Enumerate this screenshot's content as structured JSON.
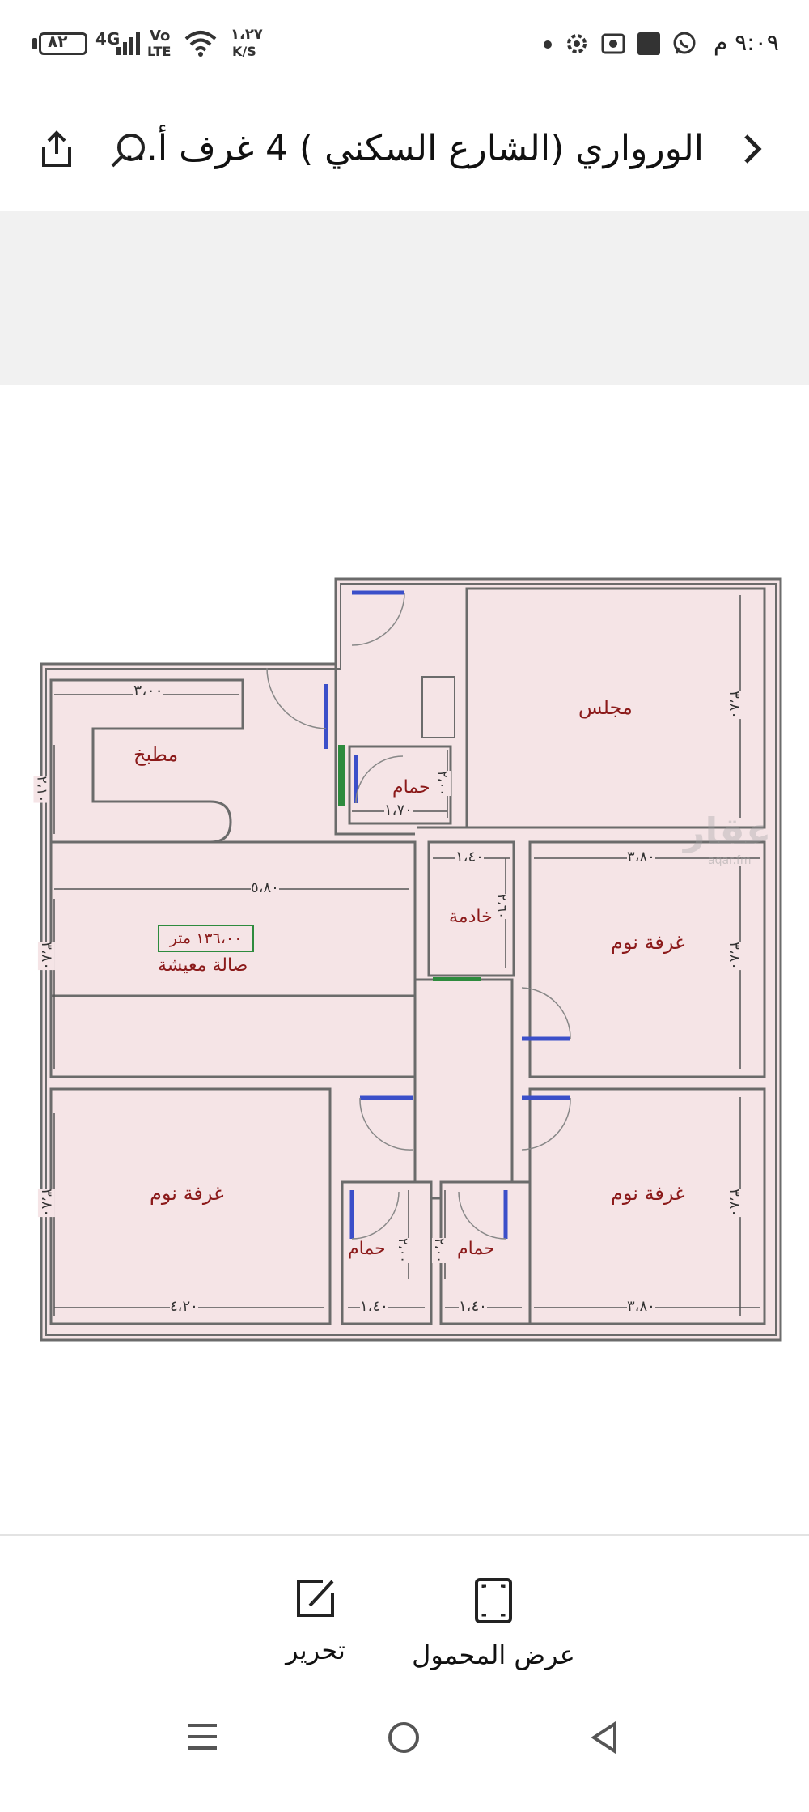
{
  "status_bar": {
    "time": "٩:٠٩ م",
    "battery": "٨٢",
    "network": "4G",
    "volte_top": "Vo",
    "volte_bottom": "LTE",
    "speed_value": "١،٢٧",
    "speed_unit": "K/S"
  },
  "header": {
    "title": "الورواري (الشارع السكني ) 4 غرف أ..."
  },
  "floor_plan": {
    "rooms": {
      "majlis": "مجلس",
      "kitchen": "مطبخ",
      "bath_top": "حمام",
      "maid": "خادمة",
      "bedroom_right_top": "غرفة نوم",
      "living": "صالة معيشة",
      "area": "١٣٦،٠٠ متر",
      "bedroom_left": "غرفة نوم",
      "bath_bottom_left": "حمام",
      "bath_bottom_right": "حمام",
      "bedroom_right_bottom": "غرفة نوم"
    },
    "dimensions": {
      "kitchen_w": "٣،٠٠",
      "kitchen_h": "٢،١٠",
      "bath_top_w": "١،٧٠",
      "bath_top_h": "٢،٠٠",
      "majlis_h": "٣،٨٠",
      "maid_w": "١،٤٠",
      "maid_h": "٢،٦٠",
      "bed_rt_w": "٣،٨٠",
      "bed_rt_h": "٣،٨٠",
      "living_w": "٥،٨٠",
      "living_h": "٣،٨٠",
      "bed_left_h": "٣،٨٠",
      "bed_left_w": "٤،٢٠",
      "bath_bl_w": "١،٤٠",
      "bath_bl_h": "٢،٠٠",
      "bath_br_w": "١،٤٠",
      "bath_br_h": "٢،٠٠",
      "bed_rb_w": "٣،٨٠",
      "bed_rb_h": "٣،٨٠"
    },
    "watermark": "عقار",
    "watermark_sub": "aqar.fm"
  },
  "actions": {
    "edit": "تحرير",
    "mobile_view": "عرض المحمول"
  },
  "colors": {
    "wall": "#6b6b6b",
    "room_fill": "#f5e4e6",
    "label": "#8b1a1a",
    "dim_line": "#555555",
    "door": "#3b4fc9",
    "area_box": "#2e8b3e"
  }
}
